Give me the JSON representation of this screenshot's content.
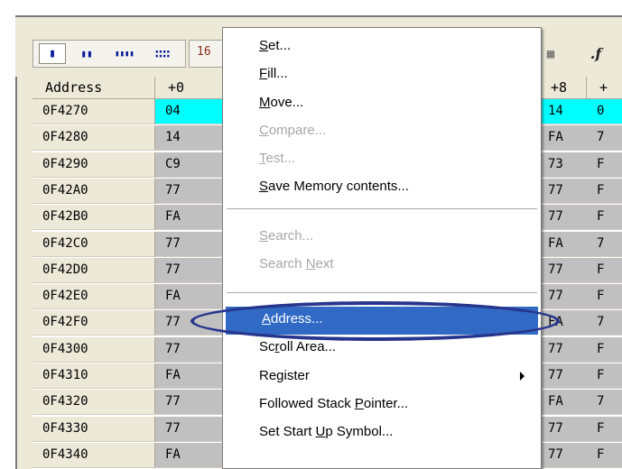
{
  "toolbar": {
    "buttons": [
      {
        "label": "▮"
      },
      {
        "label": "▮▮"
      },
      {
        "label": "▮▮▮▮"
      },
      {
        "label": "∷∷"
      }
    ],
    "hex_label": "16",
    "right_icon1": "▦",
    "right_icon2": ".f"
  },
  "grid": {
    "headers": {
      "address": "Address",
      "col0": "+0",
      "col8": "+8",
      "col9": "+"
    },
    "rows": [
      {
        "address": "0F4270",
        "b0": "04",
        "b8": "14",
        "b9": "0"
      },
      {
        "address": "0F4280",
        "b0": "14",
        "b8": "FA",
        "b9": "7"
      },
      {
        "address": "0F4290",
        "b0": "C9",
        "b8": "73",
        "b9": "F"
      },
      {
        "address": "0F42A0",
        "b0": "77",
        "b8": "77",
        "b9": "F"
      },
      {
        "address": "0F42B0",
        "b0": "FA",
        "b8": "77",
        "b9": "F"
      },
      {
        "address": "0F42C0",
        "b0": "77",
        "b8": "FA",
        "b9": "7"
      },
      {
        "address": "0F42D0",
        "b0": "77",
        "b8": "77",
        "b9": "F"
      },
      {
        "address": "0F42E0",
        "b0": "FA",
        "b8": "77",
        "b9": "F"
      },
      {
        "address": "0F42F0",
        "b0": "77",
        "b8": "FA",
        "b9": "7"
      },
      {
        "address": "0F4300",
        "b0": "77",
        "b8": "77",
        "b9": "F"
      },
      {
        "address": "0F4310",
        "b0": "FA",
        "b8": "77",
        "b9": "F"
      },
      {
        "address": "0F4320",
        "b0": "77",
        "b8": "FA",
        "b9": "7"
      },
      {
        "address": "0F4330",
        "b0": "77",
        "b8": "77",
        "b9": "F"
      },
      {
        "address": "0F4340",
        "b0": "FA",
        "b8": "77",
        "b9": "F"
      }
    ]
  },
  "context_menu": {
    "items": [
      {
        "pre": "",
        "u": "S",
        "post": "et...",
        "disabled": false
      },
      {
        "pre": "",
        "u": "F",
        "post": "ill...",
        "disabled": false
      },
      {
        "pre": "",
        "u": "M",
        "post": "ove...",
        "disabled": false
      },
      {
        "pre": "",
        "u": "C",
        "post": "ompare...",
        "disabled": true
      },
      {
        "pre": "",
        "u": "T",
        "post": "est...",
        "disabled": true
      },
      {
        "pre": "",
        "u": "S",
        "post": "ave Memory contents...",
        "disabled": false
      },
      {
        "pre": "",
        "u": "S",
        "post": "earch...",
        "disabled": true
      },
      {
        "pre": "Search ",
        "u": "N",
        "post": "ext",
        "disabled": true
      },
      {
        "pre": "",
        "u": "A",
        "post": "ddress...",
        "disabled": false,
        "selected": true
      },
      {
        "pre": "Sc",
        "u": "r",
        "post": "oll Area...",
        "disabled": false
      },
      {
        "pre": "",
        "u": "",
        "post": "Register",
        "disabled": false,
        "submenu": true
      },
      {
        "pre": "Followed Stack ",
        "u": "P",
        "post": "ointer...",
        "disabled": false
      },
      {
        "pre": "Set Start ",
        "u": "U",
        "post": "p Symbol...",
        "disabled": false
      }
    ]
  },
  "colors": {
    "selection": "#316ac5",
    "highlight_row": "#00ffff",
    "annotation": "#27368c"
  }
}
